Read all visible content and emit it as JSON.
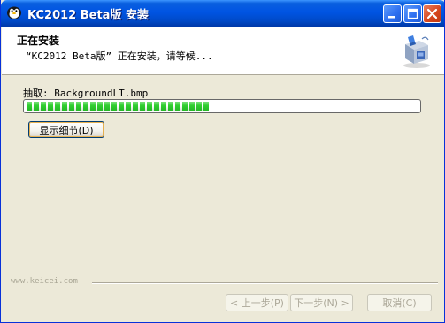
{
  "window": {
    "title": "KC2012 Beta版 安装"
  },
  "header": {
    "title": "正在安装",
    "subtitle": "“KC2012 Beta版” 正在安装，请等候..."
  },
  "main": {
    "extract_label": "抽取: BackgroundLT.bmp",
    "progress_fraction": 0.47,
    "details_button": "显示细节(D)"
  },
  "footer": {
    "brand": "www.keicei.com",
    "back_button": "< 上一步(P)",
    "next_button": "下一步(N) >",
    "cancel_button": "取消(C)"
  },
  "icons": {
    "app": "qq-penguin-icon",
    "installer": "installer-box-icon",
    "minimize": "minimize-icon",
    "maximize": "maximize-icon",
    "close": "close-icon"
  },
  "colors": {
    "titlebar": "#0054e3",
    "progress": "#2fce2f",
    "dialog_bg": "#ece9d8"
  }
}
